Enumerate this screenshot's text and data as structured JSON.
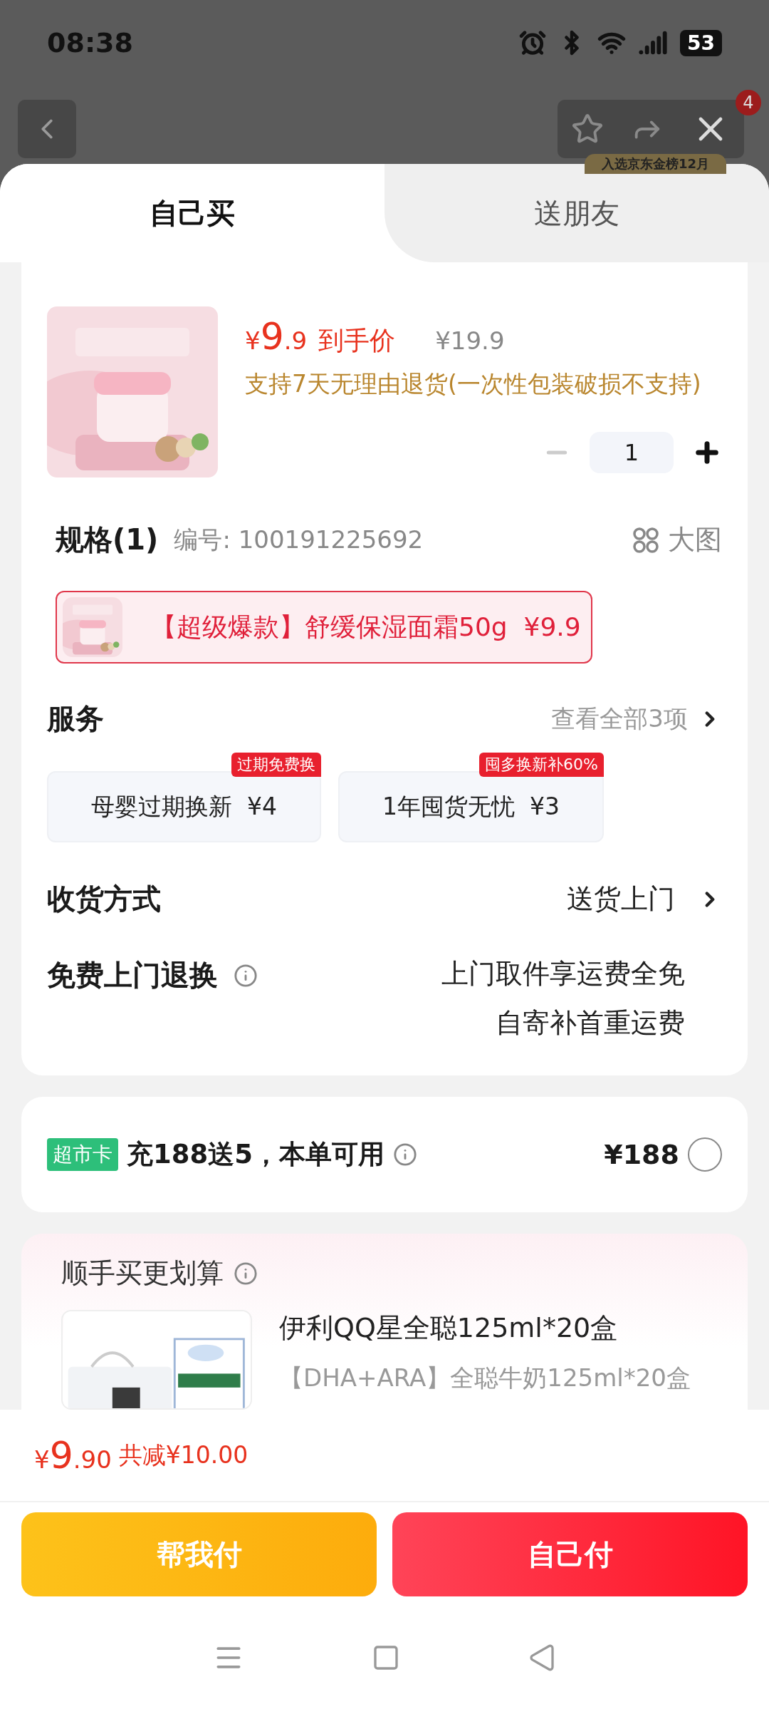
{
  "status_bar": {
    "time": "08:38",
    "battery": "53"
  },
  "background_page": {
    "banner_text": "入选京东金榜12月",
    "badge": "4"
  },
  "tabs": [
    {
      "label": "自己买",
      "selected": true
    },
    {
      "label": "送朋友",
      "selected": false
    }
  ],
  "product": {
    "currency": "¥",
    "price_int": "9",
    "price_dec": ".9",
    "price_label": "到手价",
    "original_price": "¥19.9",
    "return_policy": "支持7天无理由退货(一次性包装破损不支持)",
    "quantity": "1"
  },
  "spec": {
    "title": "规格(1)",
    "code": "编号: 100191225692",
    "big_image": "大图",
    "options": [
      {
        "label": "【超级爆款】舒缓保湿面霜50g",
        "price": "¥9.9",
        "selected": true
      }
    ]
  },
  "services": {
    "title": "服务",
    "view_all": "查看全部3项",
    "items": [
      {
        "name": "母婴过期换新",
        "price": "¥4",
        "tag": "过期免费换",
        "selected": false
      },
      {
        "name": "1年囤货无忧",
        "price": "¥3",
        "tag": "囤多换新补60%",
        "selected": false
      }
    ]
  },
  "delivery": {
    "label": "收货方式",
    "value": "送货上门"
  },
  "free_return": {
    "label": "免费上门退换",
    "lines": [
      "上门取件享运费全免",
      "自寄补首重运费"
    ]
  },
  "card_offer": {
    "tag": "超市卡",
    "text": "充188送5，本单可用",
    "price": "¥188",
    "selected": false
  },
  "addon": {
    "title": "顺手买更划算",
    "items": [
      {
        "name": "伊利QQ星全聪125ml*20盒",
        "desc": "【DHA+ARA】全聪牛奶125ml*20盒"
      }
    ]
  },
  "footer": {
    "currency": "¥",
    "total_int": "9",
    "total_dec": ".90",
    "discount": "共减¥10.00",
    "buttons": [
      {
        "label": "帮我付",
        "kind": "secondary"
      },
      {
        "label": "自己付",
        "kind": "primary"
      }
    ]
  }
}
